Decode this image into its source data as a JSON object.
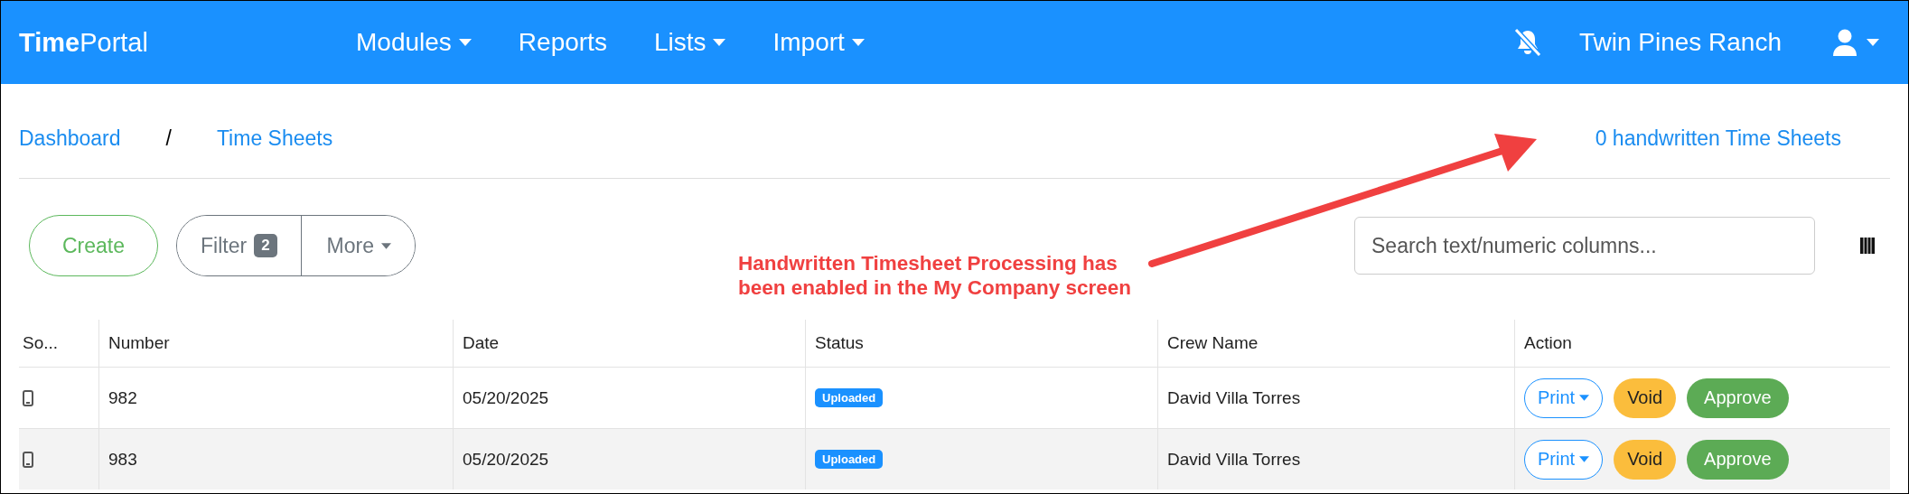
{
  "navbar": {
    "brand": {
      "bold": "Time",
      "light": "Portal"
    },
    "menu": [
      {
        "label": "Modules",
        "dropdown": true
      },
      {
        "label": "Reports",
        "dropdown": false
      },
      {
        "label": "Lists",
        "dropdown": true
      },
      {
        "label": "Import",
        "dropdown": true
      }
    ],
    "notifications_muted": true,
    "company": "Twin Pines Ranch"
  },
  "breadcrumb": [
    "Dashboard",
    "Time Sheets"
  ],
  "breadcrumb_separator": "/",
  "handwritten_link": "0 handwritten Time Sheets",
  "toolbar": {
    "create": "Create",
    "filter": "Filter",
    "filter_count": "2",
    "more": "More",
    "search": {
      "placeholder": "Search text/numeric columns..."
    }
  },
  "annotation": {
    "lines": [
      "Handwritten Timesheet Processing has",
      "been enabled in the My Company screen"
    ]
  },
  "table": {
    "columns": [
      "So...",
      "Number",
      "Date",
      "Status",
      "Crew Name",
      "Action"
    ],
    "rows": [
      {
        "kind": "mobile",
        "number": "982",
        "date": "05/20/2025",
        "status": "Uploaded",
        "crew": "David Villa Torres",
        "actions": [
          "Print",
          "Void",
          "Approve"
        ]
      },
      {
        "kind": "mobile",
        "number": "983",
        "date": "05/20/2025",
        "status": "Uploaded",
        "crew": "David Villa Torres",
        "actions": [
          "Print",
          "Void",
          "Approve"
        ]
      }
    ]
  }
}
